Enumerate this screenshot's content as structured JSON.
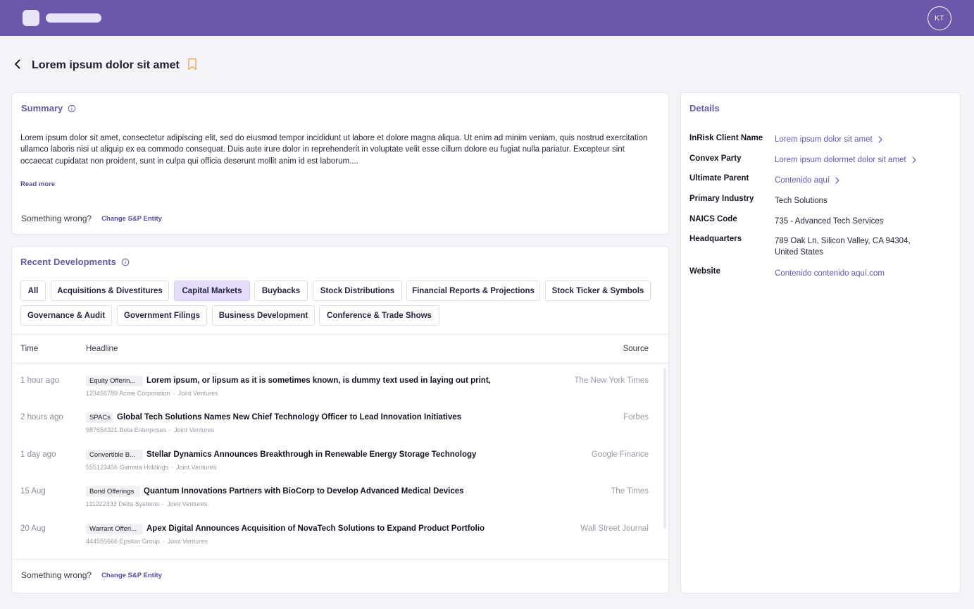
{
  "header": {
    "avatar_initials": "KT"
  },
  "page": {
    "title": "Lorem ipsum dolor sit amet"
  },
  "summary": {
    "title": "Summary",
    "text": "Lorem ipsum dolor sit amet, consectetur adipiscing elit, sed do eiusmod tempor incididunt ut labore et dolore magna aliqua. Ut enim ad minim veniam, quis nostrud exercitation ullamco laboris nisi ut aliquip ex ea commodo consequat. Duis aute irure dolor in reprehenderit in voluptate velit esse cillum dolore eu fugiat nulla pariatur. Excepteur sint occaecat cupidatat non proident, sunt in culpa qui officia deserunt mollit anim id est laborum....",
    "read_more": "Read more",
    "wrong_label": "Something wrong?",
    "wrong_link": "Change S&P Entity"
  },
  "developments": {
    "title": "Recent Developments",
    "filters": [
      "All",
      "Acquisitions & Divestitures",
      "Capital Markets",
      "Buybacks",
      "Stock Distributions",
      "Financial Reports & Projections",
      "Stock Ticker & Symbols",
      "Governance & Audit",
      "Government Filings",
      "Business Development",
      "Conference & Trade Shows"
    ],
    "active_filter": "Capital Markets",
    "columns": {
      "time": "Time",
      "headline": "Headline",
      "source": "Source"
    },
    "rows": [
      {
        "time": "1 hour ago",
        "tag": "Equity Offerin...",
        "headline": "Lorem ipsum, or lipsum as it is sometimes known, is dummy text used in laying out print,",
        "id": "123456789",
        "company": "Acme Corporation",
        "category": "Joint Ventures",
        "source": "The New York Times"
      },
      {
        "time": "2 hours ago",
        "tag": "SPACs",
        "headline": "Global Tech Solutions Names New Chief Technology Officer to Lead Innovation Initiatives",
        "id": "987654321",
        "company": "Beta Enterprises",
        "category": "Joint Ventures",
        "source": "Forbes"
      },
      {
        "time": "1 day ago",
        "tag": "Convertible B...",
        "headline": "Stellar Dynamics Announces Breakthrough in Renewable Energy Storage Technology",
        "id": "555123456",
        "company": "Gamma Holdings",
        "category": "Joint Ventures",
        "source": "Google Finance"
      },
      {
        "time": "15 Aug",
        "tag": "Bond Offerings",
        "headline": "Quantum Innovations Partners with BioCorp to Develop Advanced Medical Devices",
        "id": "111222333",
        "company": "Delta Systems",
        "category": "Joint Ventures",
        "source": "The Times"
      },
      {
        "time": "20 Aug",
        "tag": "Warrant Offeri...",
        "headline": "Apex Digital Announces Acquisition of NovaTech Solutions to Expand Product Portfolio",
        "id": "444555666",
        "company": "Epsilon Group",
        "category": "Joint Ventures",
        "source": "Wall Street Journal"
      }
    ],
    "wrong_label": "Something wrong?",
    "wrong_link": "Change S&P Entity"
  },
  "details": {
    "title": "Details",
    "items": [
      {
        "label": "InRisk Client Name",
        "value": "Lorem ipsum dolor sit amet"
      },
      {
        "label": "Convex Party",
        "value": "Lorem ipsum dolormet dolor sit amet"
      },
      {
        "label": "Ultimate Parent",
        "value": "Contenido aquí"
      },
      {
        "label": "Primary Industry",
        "value": "Tech Solutions"
      },
      {
        "label": "NAICS Code",
        "value": "735 - Advanced Tech Services"
      },
      {
        "label": "Headquarters",
        "value_line1": "789 Oak Ln, Silicon Valley, CA 94304,",
        "value_line2": "United States"
      },
      {
        "label": "Website",
        "value": "Contenido contenido aquí.com"
      }
    ]
  },
  "colors": {
    "brand": "#6a58a8",
    "active_chip": "#e4dcfa",
    "bookmark": "#f2a65a"
  },
  "icons": [
    "back-arrow-icon",
    "bookmark-icon",
    "info-icon",
    "chevron-right-icon"
  ]
}
